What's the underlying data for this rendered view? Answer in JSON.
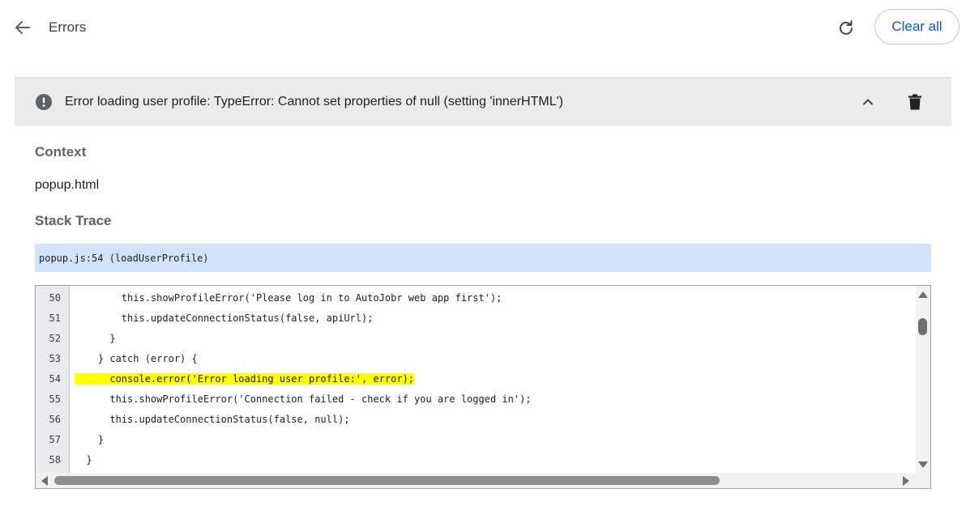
{
  "header": {
    "title": "Errors",
    "back_icon": "arrow-back-icon",
    "reload_icon": "refresh-icon",
    "clear_all_label": "Clear all"
  },
  "error": {
    "message": "Error loading user profile: TypeError: Cannot set properties of null (setting 'innerHTML')",
    "status_icon": "error-icon",
    "collapse_icon": "chevron-up-icon",
    "delete_icon": "trash-icon"
  },
  "details": {
    "context_heading": "Context",
    "context_value": "popup.html",
    "stack_heading": "Stack Trace",
    "stack_frame": "popup.js:54 (loadUserProfile)"
  },
  "code": {
    "highlight_color": "#ffff00",
    "lines": [
      {
        "num": "50",
        "text": "        this.showProfileError('Please log in to AutoJobr web app first');",
        "highlight": false
      },
      {
        "num": "51",
        "text": "        this.updateConnectionStatus(false, apiUrl);",
        "highlight": false
      },
      {
        "num": "52",
        "text": "      }",
        "highlight": false
      },
      {
        "num": "53",
        "text": "    } catch (error) {",
        "highlight": false
      },
      {
        "num": "54",
        "text": "      console.error('Error loading user profile:', error);",
        "highlight": true
      },
      {
        "num": "55",
        "text": "      this.showProfileError('Connection failed - check if you are logged in');",
        "highlight": false
      },
      {
        "num": "56",
        "text": "      this.updateConnectionStatus(false, null);",
        "highlight": false
      },
      {
        "num": "57",
        "text": "    }",
        "highlight": false
      },
      {
        "num": "58",
        "text": "  }",
        "highlight": false
      }
    ]
  },
  "colors": {
    "accent": "#0b57d0",
    "header_bg": "#ebebeb",
    "stack_frame_bg": "#d2e3fc"
  }
}
